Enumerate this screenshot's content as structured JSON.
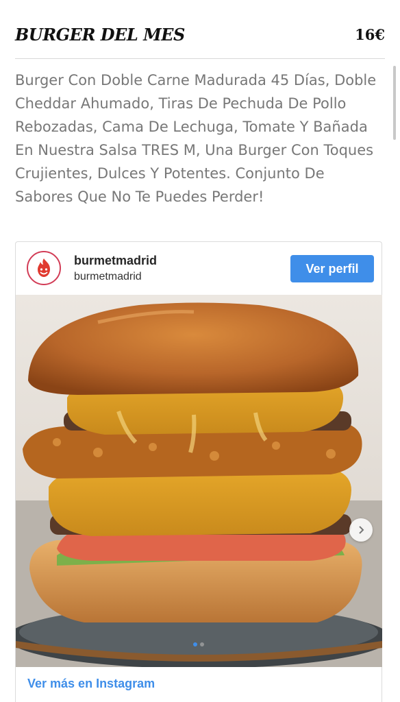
{
  "menu_item": {
    "title": "BURGER DEL MES",
    "price": "16€",
    "description": "Burger Con Doble Carne Madurada 45 Días, Doble Cheddar Ahumado, Tiras De Pechuda De Pollo Rebozadas, Cama De Lechuga, Tomate Y Bañada En Nuestra Salsa TRES M, Una Burger Con Toques Crujientes, Dulces Y Potentes. Conjunto De Sabores Que No Te Puedes Perder!"
  },
  "instagram_embed": {
    "username": "burmetmadrid",
    "handle": "burmetmadrid",
    "follow_label": "Ver perfil",
    "more_link": "Ver más en Instagram",
    "carousel": {
      "total": 2,
      "current": 1
    },
    "icons": {
      "avatar": "flame-logo-icon",
      "next": "chevron-right-icon"
    },
    "colors": {
      "accent": "#3f8ee9",
      "avatar_ring": "#d23c56"
    }
  }
}
